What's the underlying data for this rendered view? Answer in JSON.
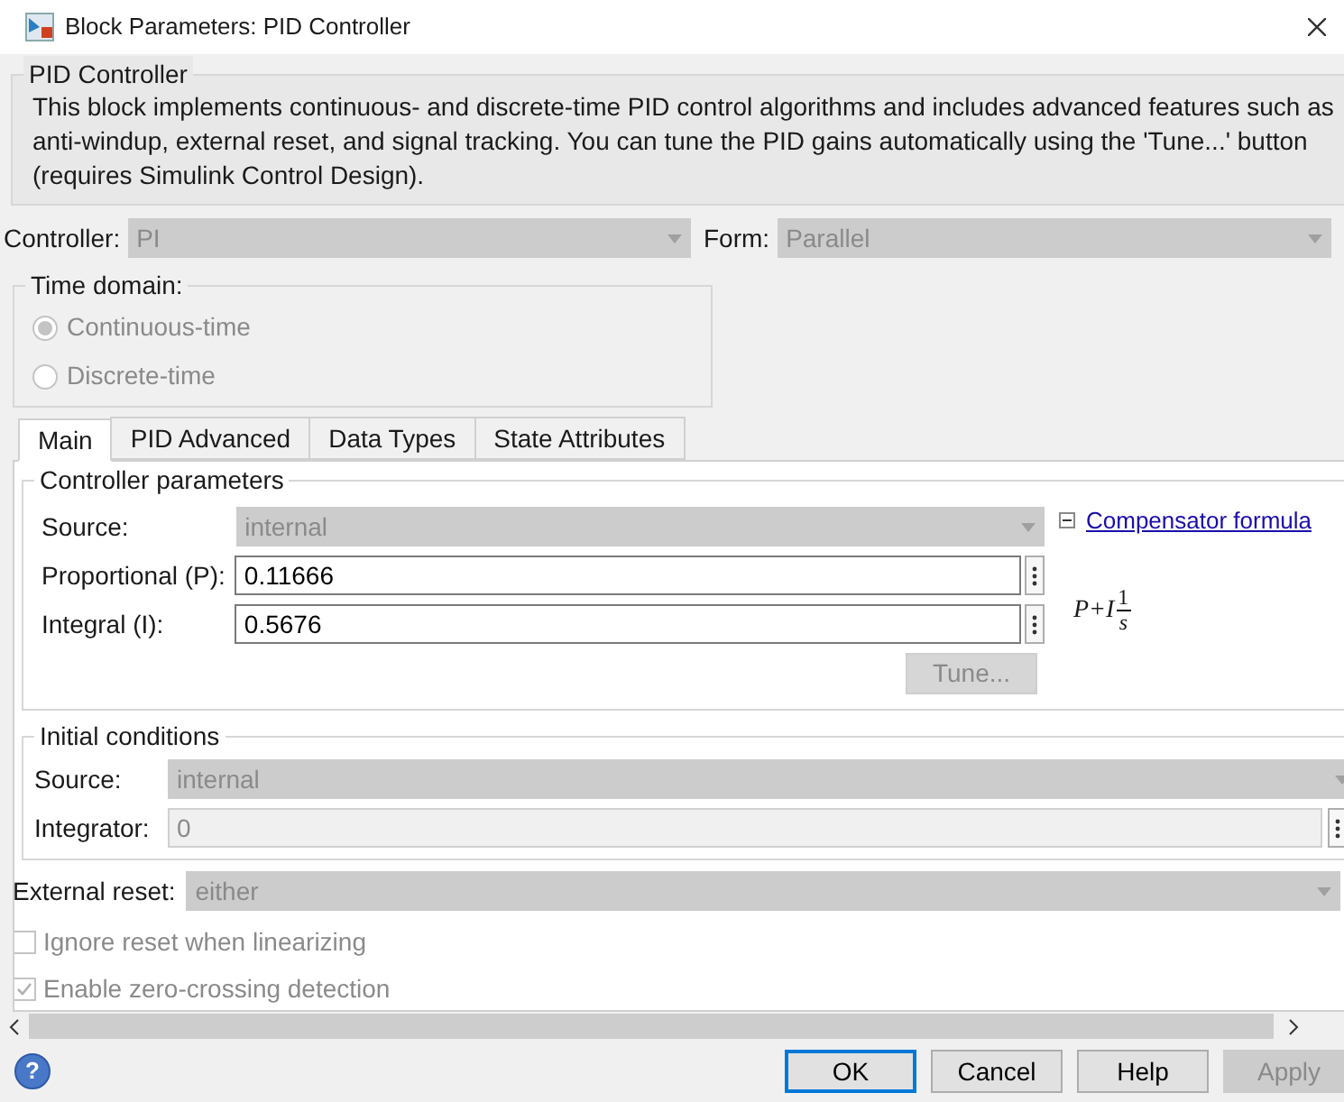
{
  "window": {
    "title": "Block Parameters: PID Controller"
  },
  "description_group": {
    "title": "PID Controller",
    "text": "This block implements continuous- and discrete-time PID control algorithms and includes advanced features such as anti-windup, external reset, and signal tracking. You can tune the PID gains automatically using the 'Tune...' button (requires Simulink Control Design)."
  },
  "controller": {
    "label": "Controller:",
    "value": "PI",
    "disabled": true
  },
  "form": {
    "label": "Form:",
    "value": "Parallel",
    "disabled": true
  },
  "time_domain": {
    "title": "Time domain:",
    "options": [
      {
        "label": "Continuous-time",
        "selected": true,
        "disabled": true
      },
      {
        "label": "Discrete-time",
        "selected": false,
        "disabled": true
      }
    ]
  },
  "tabs": [
    {
      "label": "Main",
      "selected": true
    },
    {
      "label": "PID Advanced",
      "selected": false
    },
    {
      "label": "Data Types",
      "selected": false
    },
    {
      "label": "State Attributes",
      "selected": false
    }
  ],
  "controller_parameters": {
    "title": "Controller parameters",
    "source": {
      "label": "Source:",
      "value": "internal",
      "disabled": true
    },
    "proportional": {
      "label": "Proportional (P):",
      "value": "0.11666"
    },
    "integral": {
      "label": "Integral (I):",
      "value": "0.5676"
    },
    "tune_button": {
      "label": "Tune...",
      "disabled": true
    },
    "compensator_link": "Compensator formula",
    "expanded": true,
    "formula": {
      "lhs": "P+I",
      "numerator": "1",
      "denominator": "s"
    }
  },
  "initial_conditions": {
    "title": "Initial conditions",
    "source": {
      "label": "Source:",
      "value": "internal",
      "disabled": true
    },
    "integrator": {
      "label": "Integrator:",
      "value": "0",
      "disabled": true
    }
  },
  "external_reset": {
    "label": "External reset:",
    "value": "either",
    "disabled": true
  },
  "checkboxes": [
    {
      "label": "Ignore reset when linearizing",
      "checked": false,
      "disabled": true
    },
    {
      "label": "Enable zero-crossing detection",
      "checked": true,
      "disabled": true
    }
  ],
  "help_button": "?",
  "buttons": [
    {
      "label": "OK",
      "default": true,
      "disabled": false
    },
    {
      "label": "Cancel",
      "default": false,
      "disabled": false
    },
    {
      "label": "Help",
      "default": false,
      "disabled": false
    },
    {
      "label": "Apply",
      "default": false,
      "disabled": true
    }
  ]
}
